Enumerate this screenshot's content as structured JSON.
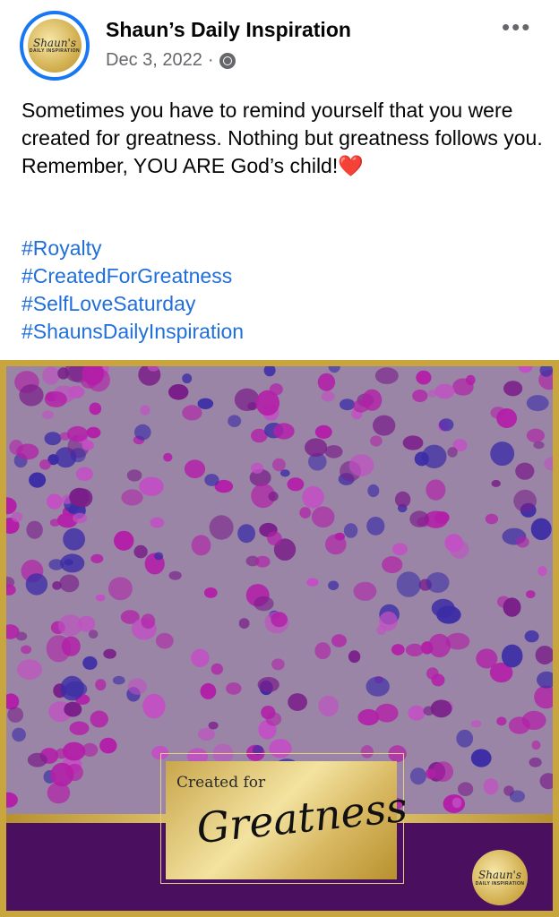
{
  "post": {
    "page_name": "Shaun’s Daily Inspiration",
    "date": "Dec 3, 2022",
    "separator": "·",
    "privacy_icon": "globe-icon",
    "more_icon": "more-horizontal-icon",
    "avatar": {
      "script": "Shaun's",
      "small": "DAILY INSPIRATION"
    },
    "text": "Sometimes you have to remind yourself that you were created for greatness. Nothing but greatness follows you. Remember, YOU ARE God’s child!",
    "emoji": "❤️",
    "hashtags": [
      "#Royalty",
      "#CreatedForGreatness",
      "#SelfLoveSaturday",
      "#ShaunsDailyInspiration"
    ]
  },
  "image": {
    "card_top": "Created for",
    "card_script": "Greatness",
    "badge_script": "Shaun's",
    "badge_small": "DAILY INSPIRATION",
    "colors": {
      "background": "#9a85a6",
      "gold": "#c9a53d",
      "purple": "#4a0f5e",
      "magenta": "#b31fa8",
      "blue": "#3b2ca6"
    }
  }
}
